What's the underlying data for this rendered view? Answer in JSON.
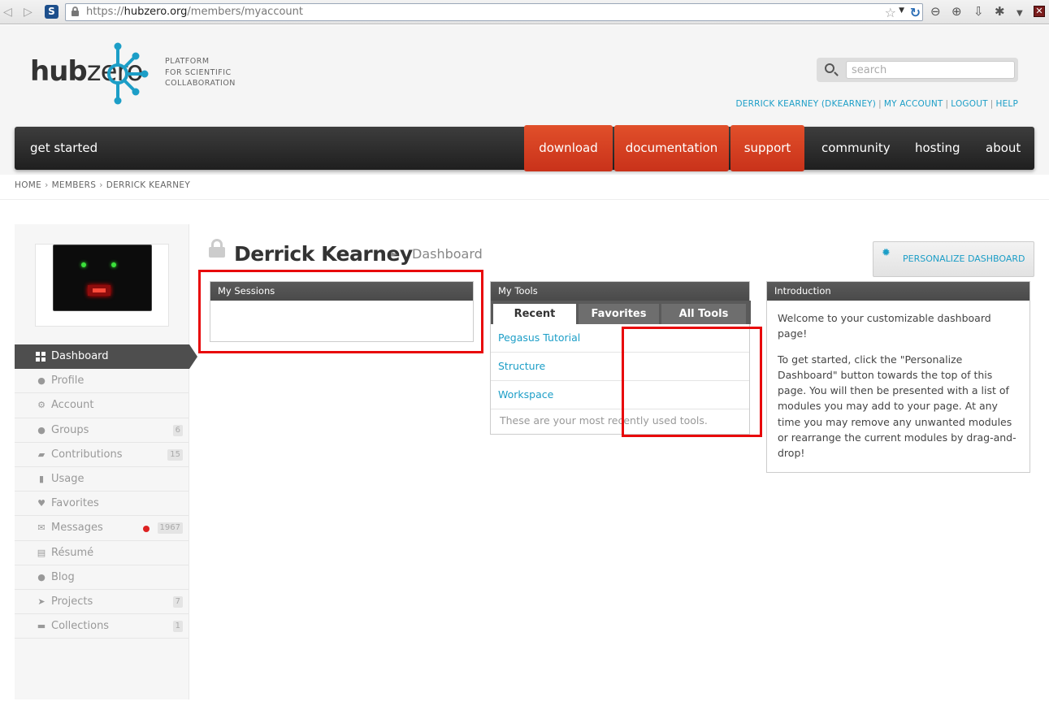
{
  "browser": {
    "url_prefix": "https://",
    "url_host": "hubzero.org",
    "url_path": "/members/myaccount",
    "site_identity": "S"
  },
  "header": {
    "logo_hub": "hub",
    "logo_zero": "zero",
    "tagline_1": "PLATFORM",
    "tagline_2": "FOR SCIENTIFIC",
    "tagline_3": "COLLABORATION",
    "search_placeholder": "search",
    "user_link": "DERRICK KEARNEY (DKEARNEY)",
    "my_account": "MY ACCOUNT",
    "logout": "LOGOUT",
    "help": "HELP"
  },
  "nav": {
    "get_started": "get started",
    "download": "download",
    "documentation": "documentation",
    "support": "support",
    "community": "community",
    "hosting": "hosting",
    "about": "about"
  },
  "breadcrumb": {
    "home": "HOME",
    "members": "MEMBERS",
    "current": "DERRICK KEARNEY"
  },
  "sidebar": {
    "items": [
      {
        "label": "Dashboard",
        "icon": "dashboard-grid-icon",
        "active": true
      },
      {
        "label": "Profile",
        "icon": "person-icon"
      },
      {
        "label": "Account",
        "icon": "gears-icon"
      },
      {
        "label": "Groups",
        "icon": "group-icon",
        "count": "6"
      },
      {
        "label": "Contributions",
        "icon": "book-icon",
        "count": "15"
      },
      {
        "label": "Usage",
        "icon": "bar-chart-icon"
      },
      {
        "label": "Favorites",
        "icon": "heart-icon"
      },
      {
        "label": "Messages",
        "icon": "envelope-icon",
        "count": "1967",
        "unread_dot": true
      },
      {
        "label": "Résumé",
        "icon": "document-icon"
      },
      {
        "label": "Blog",
        "icon": "speech-bubble-icon"
      },
      {
        "label": "Projects",
        "icon": "paper-plane-icon",
        "count": "7"
      },
      {
        "label": "Collections",
        "icon": "basket-icon",
        "count": "1"
      }
    ]
  },
  "content": {
    "title": "Derrick Kearney",
    "subtitle": "Dashboard",
    "personalize_label": "PERSONALIZE DASHBOARD"
  },
  "modules": {
    "sessions": {
      "title": "My Sessions"
    },
    "tools": {
      "title": "My Tools",
      "tabs": [
        "Recent",
        "Favorites",
        "All Tools"
      ],
      "active_tab": "Recent",
      "items": [
        "Pegasus Tutorial",
        "Structure",
        "Workspace"
      ],
      "footer": "These are your most recently used tools."
    },
    "intro": {
      "title": "Introduction",
      "p1": "Welcome to your customizable dashboard page!",
      "p2": "To get started, click the \"Personalize Dashboard\" button towards the top of this page. You will then be presented with a list of modules you may add to your page. At any time you may remove any unwanted modules or rearrange the current modules by drag-and-drop!"
    }
  },
  "colors": {
    "accent_link": "#1c9ec7",
    "nav_red": "#d63c1f",
    "highlight_red": "#e8080a"
  }
}
